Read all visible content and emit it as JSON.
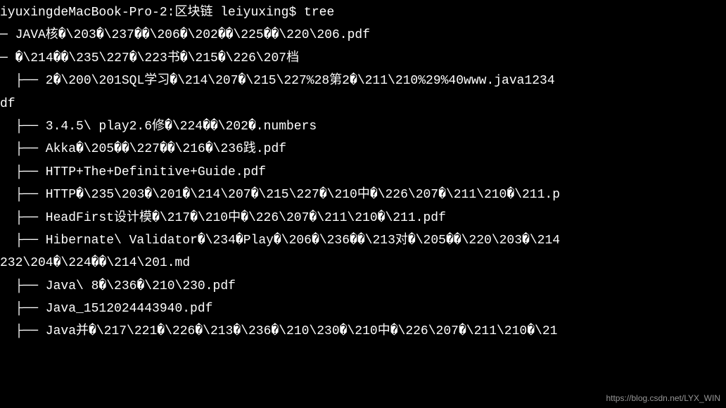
{
  "terminal": {
    "prompt_line": "iyuxingdeMacBook-Pro-2:区块链 leiyuxing$ tree",
    "blank_line": "",
    "lines": [
      "─ JAVA核�\\203�\\237��\\206�\\202��\\225��\\220\\206.pdf",
      "─ �\\214��\\235\\227�\\223书�\\215�\\226\\207档",
      "  ├── 2�\\200\\201SQL学习�\\214\\207�\\215\\227%28第2�\\211\\210%29%40www.java1234",
      "df",
      "  ├── 3.4.5\\ play2.6修�\\224��\\202�.numbers",
      "  ├── Akka�\\205��\\227��\\216�\\236践.pdf",
      "  ├── HTTP+The+Definitive+Guide.pdf",
      "  ├── HTTP�\\235\\203�\\201�\\214\\207�\\215\\227�\\210中�\\226\\207�\\211\\210�\\211.p",
      "  ├── HeadFirst设计模�\\217�\\210中�\\226\\207�\\211\\210�\\211.pdf",
      "  ├── Hibernate\\ Validator�\\234�Play�\\206�\\236��\\213对�\\205��\\220\\203�\\214",
      "232\\204�\\224��\\214\\201.md",
      "  ├── Java\\ 8�\\236�\\210\\230.pdf",
      "  ├── Java_1512024443940.pdf",
      "  ├── Java并�\\217\\221�\\226�\\213�\\236�\\210\\230�\\210中�\\226\\207�\\211\\210�\\21"
    ]
  },
  "watermark": "https://blog.csdn.net/LYX_WIN"
}
